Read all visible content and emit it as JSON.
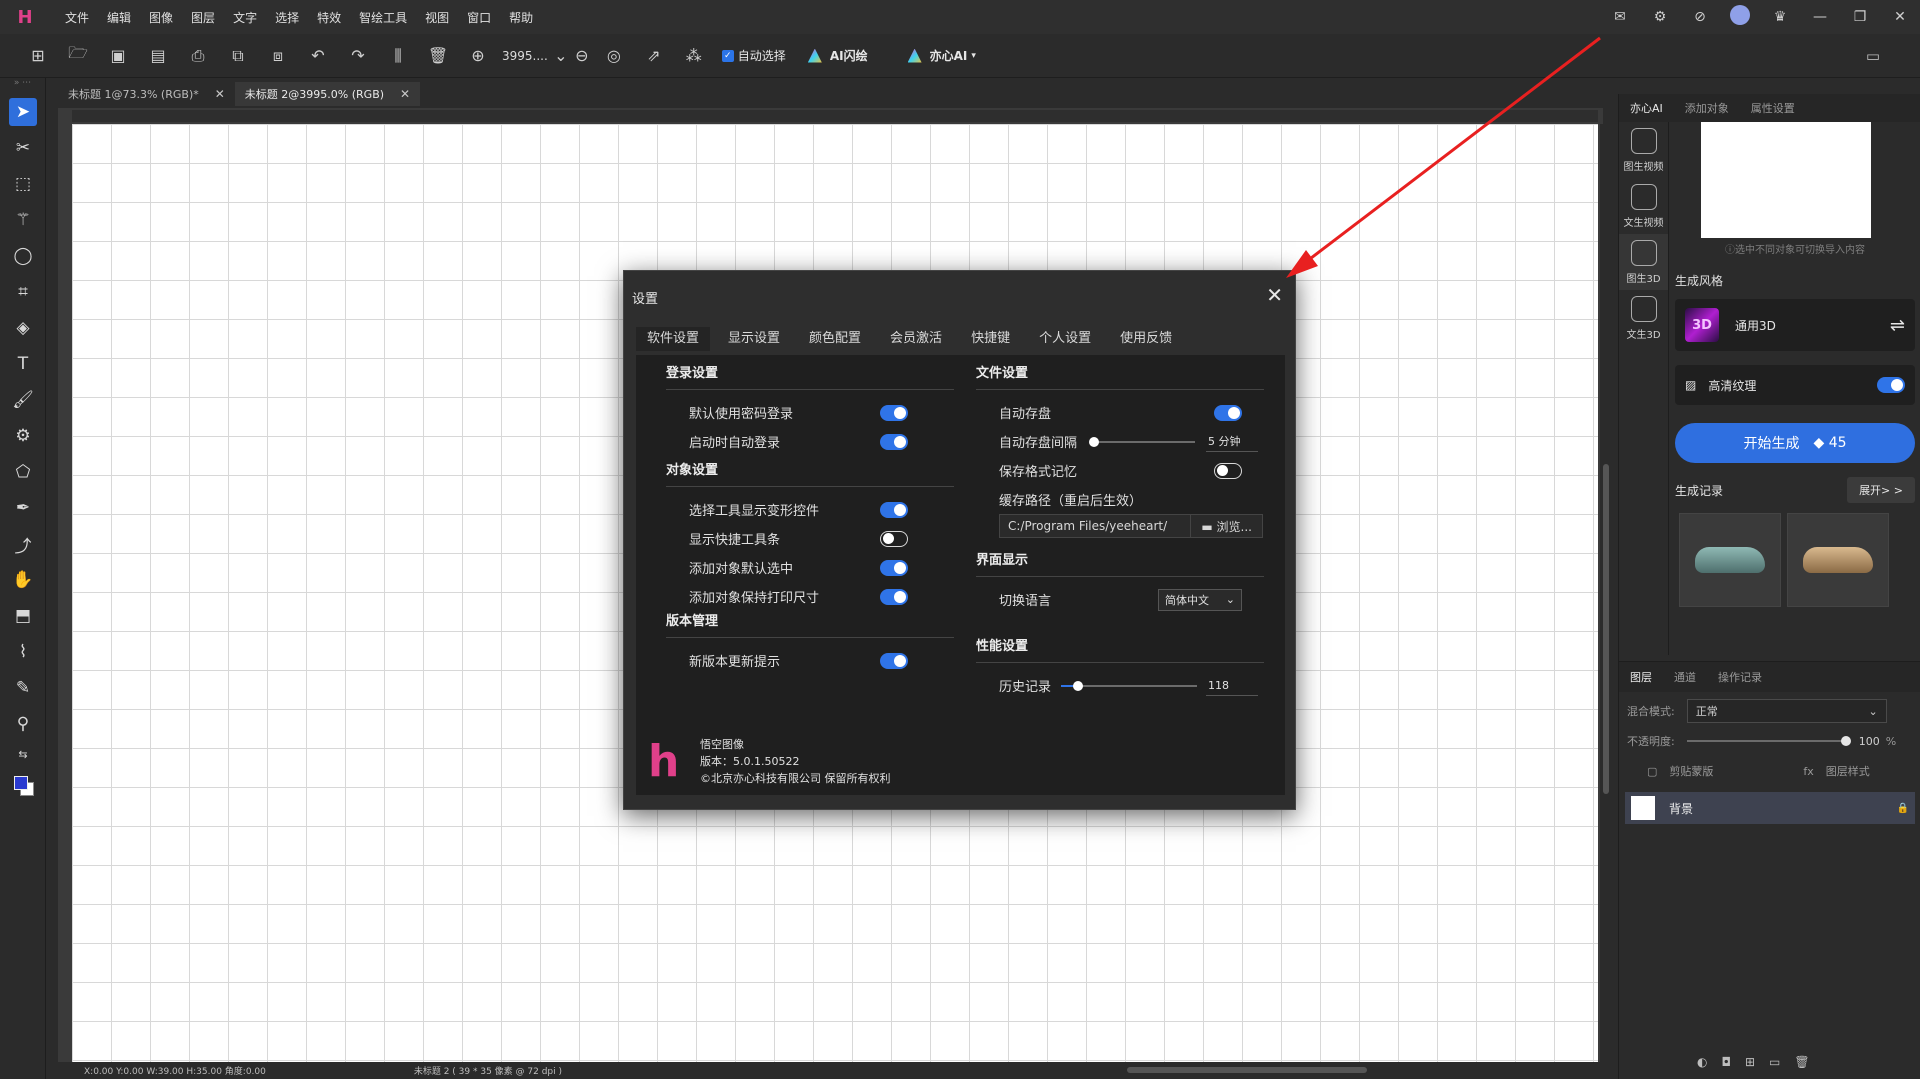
{
  "menubar": {
    "logo": "H",
    "items": [
      "文件",
      "编辑",
      "图像",
      "图层",
      "文字",
      "选择",
      "特效",
      "智绘工具",
      "视图",
      "窗口",
      "帮助"
    ]
  },
  "toolbar": {
    "zoom_value": "3995....",
    "auto_select_label": "自动选择",
    "ai_flash_label": "AI闪绘",
    "yixin_label": "亦心AI"
  },
  "doc_tabs": [
    {
      "label": "未标题 1@73.3% (RGB)*"
    },
    {
      "label": "未标题 2@3995.0% (RGB)"
    }
  ],
  "statusbar": {
    "coords": "X:0.00 Y:0.00 W:39.00 H:35.00 角度:0.00",
    "docinfo": "未标题 2 ( 39 * 35 像素 @ 72 dpi )"
  },
  "right_panel": {
    "tabs": [
      "亦心AI",
      "添加对象",
      "属性设置"
    ],
    "side_items": [
      "图生视频",
      "文生视频",
      "图生3D",
      "文生3D"
    ],
    "hint": "ⓘ选中不同对象可切换导入内容",
    "style_section": "生成风格",
    "style_name": "通用3D",
    "hd_label": "高清纹理",
    "generate_label": "开始生成",
    "generate_cost": "◆ 45",
    "records_label": "生成记录",
    "expand_label": "展开> >",
    "layer_tabs": [
      "图层",
      "通道",
      "操作记录"
    ],
    "blend_label": "混合模式:",
    "blend_value": "正常",
    "opacity_label": "不透明度:",
    "opacity_value": "100",
    "opacity_unit": "%",
    "clip_label": "剪贴蒙版",
    "layer_style_label": "图层样式",
    "layer_name": "背景"
  },
  "dialog": {
    "title": "设置",
    "tabs": [
      "软件设置",
      "显示设置",
      "颜色配置",
      "会员激活",
      "快捷键",
      "个人设置",
      "使用反馈"
    ],
    "login_group": "登录设置",
    "login_opts": [
      "默认使用密码登录",
      "启动时自动登录"
    ],
    "object_group": "对象设置",
    "object_opts": [
      "选择工具显示变形控件",
      "显示快捷工具条",
      "添加对象默认选中",
      "添加对象保持打印尺寸"
    ],
    "version_group": "版本管理",
    "version_opts": [
      "新版本更新提示"
    ],
    "file_group": "文件设置",
    "auto_save": "自动存盘",
    "auto_save_interval": "自动存盘间隔",
    "auto_save_interval_value": "5 分钟",
    "save_format_memory": "保存格式记忆",
    "cache_path_label": "缓存路径（重启后生效）",
    "cache_path": "C:/Program Files/yeeheart/",
    "browse": "浏览...",
    "ui_group": "界面显示",
    "language_label": "切换语言",
    "language_value": "简体中文",
    "perf_group": "性能设置",
    "history_label": "历史记录",
    "history_value": "118",
    "about_name": "悟空图像",
    "about_version": "版本：5.0.1.50522",
    "about_copyright": "©北京亦心科技有限公司 保留所有权利"
  },
  "colors": {
    "accent": "#2f74e8",
    "brand": "#e0408a",
    "annotation_arrow": "#e82020"
  }
}
